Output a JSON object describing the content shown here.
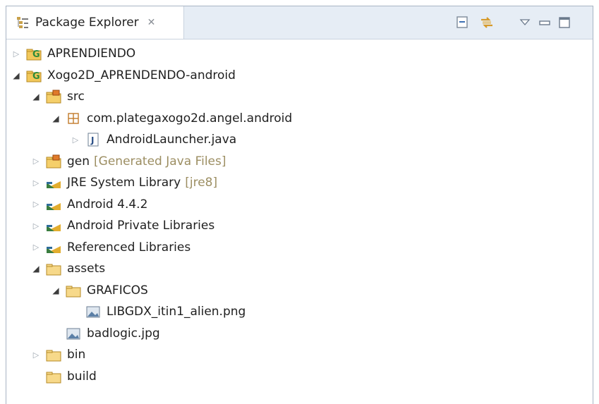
{
  "view": {
    "title": "Package Explorer",
    "close_glyph": "✕"
  },
  "toolbar": [
    {
      "icon": "collapse-all-icon"
    },
    {
      "icon": "link-with-editor-icon"
    },
    {
      "icon": "view-menu-icon"
    },
    {
      "icon": "minimize-icon"
    },
    {
      "icon": "maximize-icon"
    }
  ],
  "tree": [
    {
      "label": "APRENDIENDO",
      "icon": "android-project-icon",
      "expanded": false,
      "depth": 0
    },
    {
      "label": "Xogo2D_APRENDENDO-android",
      "icon": "android-project-icon",
      "expanded": true,
      "depth": 0
    },
    {
      "label": "src",
      "icon": "source-folder-icon",
      "expanded": true,
      "depth": 1
    },
    {
      "label": "com.plategaxogo2d.angel.android",
      "icon": "package-icon",
      "expanded": true,
      "depth": 2
    },
    {
      "label": "AndroidLauncher.java",
      "icon": "java-file-icon",
      "expanded": false,
      "depth": 3
    },
    {
      "label": "gen",
      "decoration": "[Generated Java Files]",
      "icon": "source-folder-icon",
      "expanded": false,
      "depth": 1
    },
    {
      "label": "JRE System Library",
      "decoration": "[jre8]",
      "icon": "library-icon",
      "expanded": false,
      "depth": 1
    },
    {
      "label": "Android 4.4.2",
      "icon": "library-icon",
      "expanded": false,
      "depth": 1
    },
    {
      "label": "Android Private Libraries",
      "icon": "library-icon",
      "expanded": false,
      "depth": 1
    },
    {
      "label": "Referenced Libraries",
      "icon": "library-icon",
      "expanded": false,
      "depth": 1
    },
    {
      "label": "assets",
      "icon": "folder-icon",
      "expanded": true,
      "depth": 1
    },
    {
      "label": "GRAFICOS",
      "icon": "folder-icon",
      "expanded": true,
      "depth": 2
    },
    {
      "label": "LIBGDX_itin1_alien.png",
      "icon": "image-file-icon",
      "expanded": null,
      "depth": 3
    },
    {
      "label": "badlogic.jpg",
      "icon": "image-file-icon",
      "expanded": null,
      "depth": 2
    },
    {
      "label": "bin",
      "icon": "folder-icon",
      "expanded": false,
      "depth": 1
    },
    {
      "label": "build",
      "icon": "folder-icon",
      "expanded": null,
      "depth": 1
    }
  ]
}
